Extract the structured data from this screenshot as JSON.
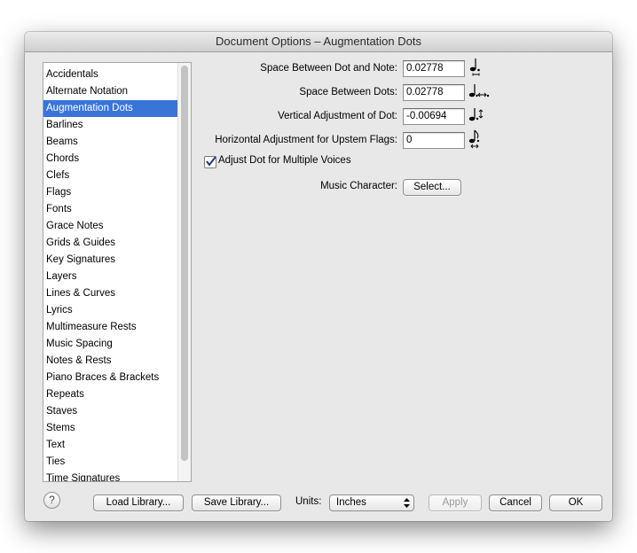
{
  "window": {
    "title": "Document Options – Augmentation Dots"
  },
  "sidebar": {
    "selected": "Augmentation Dots",
    "items": [
      "Accidentals",
      "Alternate Notation",
      "Augmentation Dots",
      "Barlines",
      "Beams",
      "Chords",
      "Clefs",
      "Flags",
      "Fonts",
      "Grace Notes",
      "Grids & Guides",
      "Key Signatures",
      "Layers",
      "Lines & Curves",
      "Lyrics",
      "Multimeasure Rests",
      "Music Spacing",
      "Notes & Rests",
      "Piano Braces & Brackets",
      "Repeats",
      "Staves",
      "Stems",
      "Text",
      "Ties",
      "Time Signatures"
    ]
  },
  "settings": {
    "dot_note_space": {
      "label": "Space Between Dot and Note:",
      "value": "0.02778",
      "icon": "dot-note-spacing-icon"
    },
    "dots_space": {
      "label": "Space Between Dots:",
      "value": "0.02778",
      "icon": "dots-spacing-icon"
    },
    "vertical_adjust": {
      "label": "Vertical Adjustment of Dot:",
      "value": "-0.00694",
      "icon": "vertical-dot-adjust-icon"
    },
    "horizontal_upstem": {
      "label": "Horizontal Adjustment for Upstem Flags:",
      "value": "0",
      "icon": "upstem-flag-adjust-icon"
    },
    "multiple_voices": {
      "label": "Adjust Dot for Multiple Voices",
      "checked": true
    },
    "music_character": {
      "label": "Music Character:",
      "button": "Select..."
    }
  },
  "footer": {
    "help": "?",
    "load_library": "Load Library...",
    "save_library": "Save Library...",
    "units_label": "Units:",
    "units_value": "Inches",
    "apply": "Apply",
    "cancel": "Cancel",
    "ok": "OK"
  },
  "colors": {
    "selection": "#3875d7",
    "window_bg": "#e8e8e8",
    "checkbox_check": "#1f3a6e"
  }
}
